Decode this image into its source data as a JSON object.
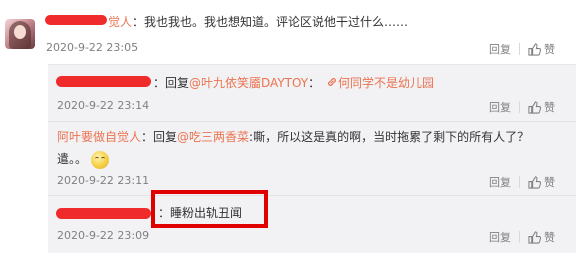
{
  "colors": {
    "accent": "#eb7350",
    "highlight_box": "#e10000",
    "redaction": "#ef2b2b"
  },
  "comment": {
    "user_suffix": "觉人",
    "text": "：我也我也。我也想知道。评论区说他干过什么……",
    "time": "2020-9-22 23:05",
    "reply_label": "回复",
    "like_label": "赞"
  },
  "replies": [
    {
      "text_prefix": "：回复",
      "mention": "@叶九依笑靥DAYTOY",
      "colon": "：",
      "link_icon": "link-icon",
      "link_text": "何同学不是幼儿园",
      "time": "2020-9-22 23:14",
      "reply_label": "回复",
      "like_label": "赞"
    },
    {
      "user": "阿叶要做自觉人",
      "text_prefix": "：回复",
      "mention": "@吃三两香菜",
      "text": ":嘶，所以这是真的啊，当时拖累了剩下的所有人了？",
      "text2": "遣。。",
      "time": "2020-9-22 23:11",
      "reply_label": "回复",
      "like_label": "赞"
    },
    {
      "text": "：睡粉出轨丑闻",
      "time": "2020-9-22 23:09",
      "reply_label": "回复",
      "like_label": "赞"
    }
  ]
}
